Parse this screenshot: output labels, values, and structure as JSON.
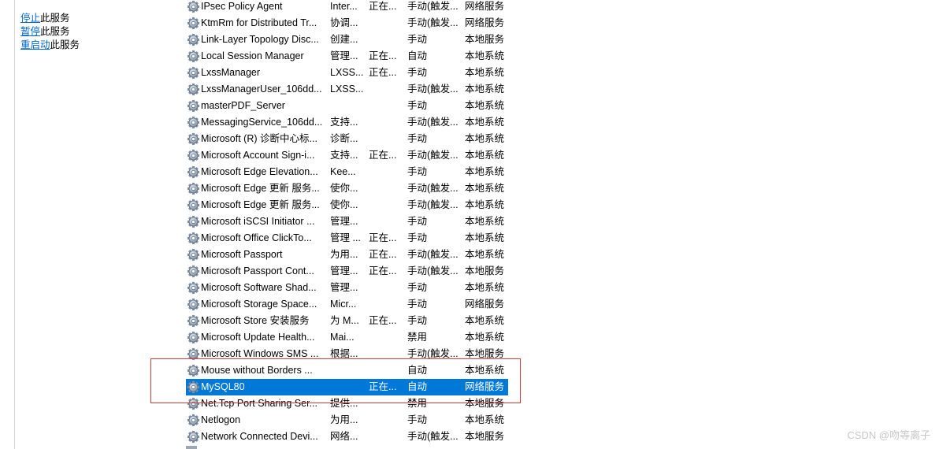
{
  "actions": [
    {
      "link": "停止",
      "suffix": "此服务"
    },
    {
      "link": "暂停",
      "suffix": "此服务"
    },
    {
      "link": "重启动",
      "suffix": "此服务"
    }
  ],
  "services": [
    {
      "name": "IPsec Policy Agent",
      "description": "Inter...",
      "status": "正在...",
      "startup": "手动(触发...",
      "logon": "网络服务"
    },
    {
      "name": "KtmRm for Distributed Tr...",
      "description": "协调...",
      "status": "",
      "startup": "手动(触发...",
      "logon": "网络服务"
    },
    {
      "name": "Link-Layer Topology Disc...",
      "description": "创建...",
      "status": "",
      "startup": "手动",
      "logon": "本地服务"
    },
    {
      "name": "Local Session Manager",
      "description": "管理...",
      "status": "正在...",
      "startup": "自动",
      "logon": "本地系统"
    },
    {
      "name": "LxssManager",
      "description": "LXSS...",
      "status": "正在...",
      "startup": "手动",
      "logon": "本地系统"
    },
    {
      "name": "LxssManagerUser_106dd...",
      "description": "LXSS...",
      "status": "",
      "startup": "手动(触发...",
      "logon": "本地系统"
    },
    {
      "name": "masterPDF_Server",
      "description": "",
      "status": "",
      "startup": "手动",
      "logon": "本地系统"
    },
    {
      "name": "MessagingService_106dd...",
      "description": "支持...",
      "status": "",
      "startup": "手动(触发...",
      "logon": "本地系统"
    },
    {
      "name": "Microsoft (R) 诊断中心标...",
      "description": "诊断...",
      "status": "",
      "startup": "手动",
      "logon": "本地系统"
    },
    {
      "name": "Microsoft Account Sign-i...",
      "description": "支持...",
      "status": "正在...",
      "startup": "手动(触发...",
      "logon": "本地系统"
    },
    {
      "name": "Microsoft Edge Elevation...",
      "description": "Kee...",
      "status": "",
      "startup": "手动",
      "logon": "本地系统"
    },
    {
      "name": "Microsoft Edge 更新 服务...",
      "description": "使你...",
      "status": "",
      "startup": "手动(触发...",
      "logon": "本地系统"
    },
    {
      "name": "Microsoft Edge 更新 服务...",
      "description": "使你...",
      "status": "",
      "startup": "手动(触发...",
      "logon": "本地系统"
    },
    {
      "name": "Microsoft iSCSI Initiator ...",
      "description": "管理...",
      "status": "",
      "startup": "手动",
      "logon": "本地系统"
    },
    {
      "name": "Microsoft Office ClickTo...",
      "description": "管理 ...",
      "status": "正在...",
      "startup": "手动",
      "logon": "本地系统"
    },
    {
      "name": "Microsoft Passport",
      "description": "为用...",
      "status": "正在...",
      "startup": "手动(触发...",
      "logon": "本地系统"
    },
    {
      "name": "Microsoft Passport Cont...",
      "description": "管理...",
      "status": "正在...",
      "startup": "手动(触发...",
      "logon": "本地服务"
    },
    {
      "name": "Microsoft Software Shad...",
      "description": "管理...",
      "status": "",
      "startup": "手动",
      "logon": "本地系统"
    },
    {
      "name": "Microsoft Storage Space...",
      "description": "Micr...",
      "status": "",
      "startup": "手动",
      "logon": "网络服务"
    },
    {
      "name": "Microsoft Store 安装服务",
      "description": "为 M...",
      "status": "正在...",
      "startup": "手动",
      "logon": "本地系统"
    },
    {
      "name": "Microsoft Update Health...",
      "description": "Mai...",
      "status": "",
      "startup": "禁用",
      "logon": "本地系统"
    },
    {
      "name": "Microsoft Windows SMS ...",
      "description": "根据...",
      "status": "",
      "startup": "手动(触发...",
      "logon": "本地服务"
    },
    {
      "name": "Mouse without Borders ...",
      "description": "",
      "status": "",
      "startup": "自动",
      "logon": "本地系统"
    },
    {
      "name": "MySQL80",
      "description": "",
      "status": "正在...",
      "startup": "自动",
      "logon": "网络服务"
    },
    {
      "name": "Net.Tcp Port Sharing Ser...",
      "description": "提供...",
      "status": "",
      "startup": "禁用",
      "logon": "本地服务"
    },
    {
      "name": "Netlogon",
      "description": "为用...",
      "status": "",
      "startup": "手动",
      "logon": "本地系统"
    },
    {
      "name": "Network Connected Devi...",
      "description": "网络...",
      "status": "",
      "startup": "手动(触发...",
      "logon": "本地服务"
    }
  ],
  "selected_index": 23,
  "watermark": "CSDN @吻等离子",
  "colors": {
    "link": "#0066cc",
    "selection": "#0078d7",
    "highlight_box": "#d23a3a"
  }
}
